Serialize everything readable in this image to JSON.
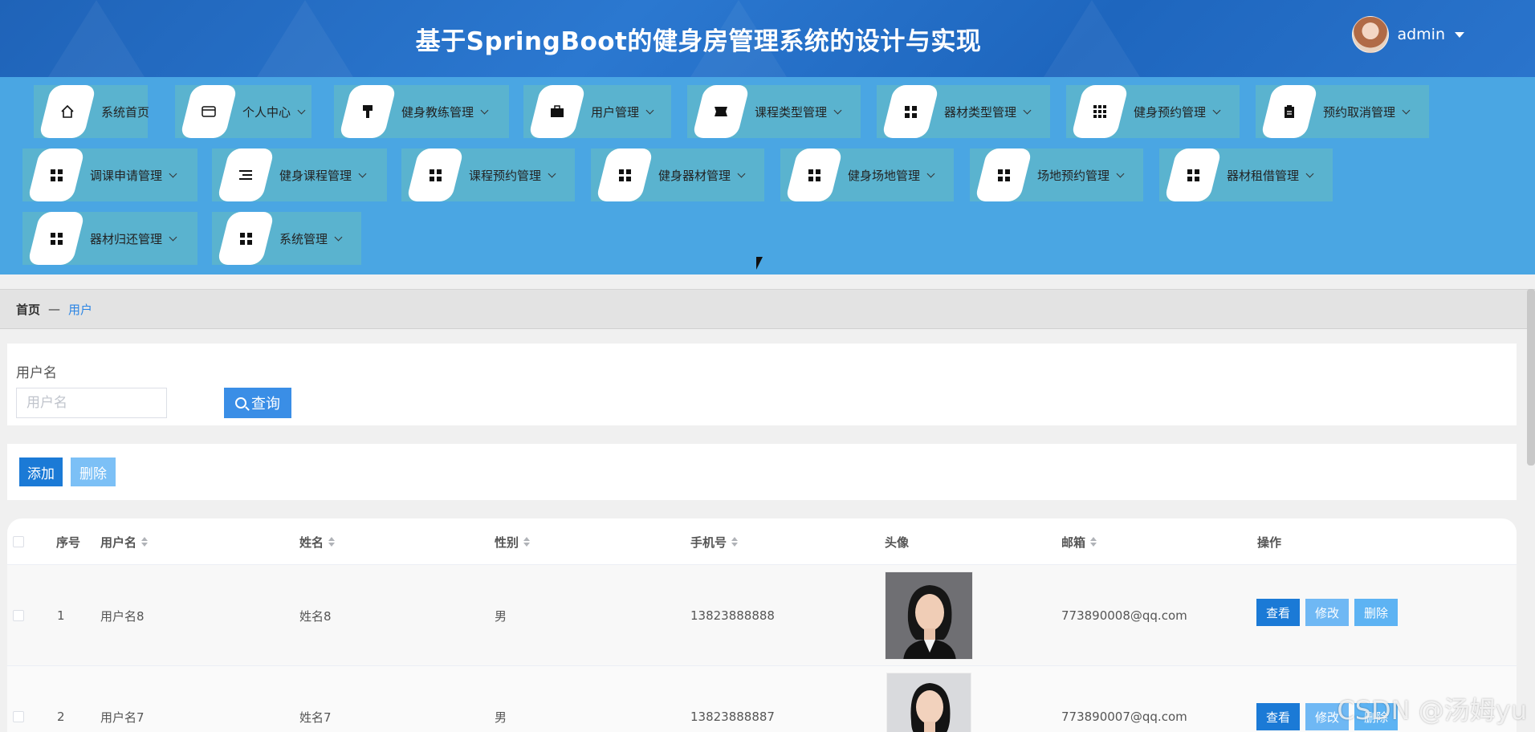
{
  "header": {
    "title": "基于SpringBoot的健身房管理系统的设计与实现",
    "username": "admin"
  },
  "nav": {
    "items": [
      {
        "label": "系统首页",
        "icon": "home-icon"
      },
      {
        "label": "个人中心",
        "icon": "wallet-icon"
      },
      {
        "label": "健身教练管理",
        "icon": "brush-icon"
      },
      {
        "label": "用户管理",
        "icon": "briefcase-icon"
      },
      {
        "label": "课程类型管理",
        "icon": "ticket-icon"
      },
      {
        "label": "器材类型管理",
        "icon": "grid-icon"
      },
      {
        "label": "健身预约管理",
        "icon": "grid9-icon"
      },
      {
        "label": "预约取消管理",
        "icon": "clipboard-icon"
      },
      {
        "label": "调课申请管理",
        "icon": "grid-icon"
      },
      {
        "label": "健身课程管理",
        "icon": "list-icon"
      },
      {
        "label": "课程预约管理",
        "icon": "grid-icon"
      },
      {
        "label": "健身器材管理",
        "icon": "grid-icon"
      },
      {
        "label": "健身场地管理",
        "icon": "grid-icon"
      },
      {
        "label": "场地预约管理",
        "icon": "grid-icon"
      },
      {
        "label": "器材租借管理",
        "icon": "grid-icon"
      },
      {
        "label": "器材归还管理",
        "icon": "grid-icon"
      },
      {
        "label": "系统管理",
        "icon": "grid-icon"
      }
    ]
  },
  "breadcrumb": {
    "home": "首页",
    "separator": "—",
    "current": "用户"
  },
  "search": {
    "label": "用户名",
    "placeholder": "用户名",
    "value": "",
    "button": "查询"
  },
  "actions": {
    "add": "添加",
    "delete": "删除"
  },
  "table": {
    "columns": {
      "index": "序号",
      "username": "用户名",
      "name": "姓名",
      "gender": "性别",
      "phone": "手机号",
      "avatar": "头像",
      "email": "邮箱",
      "ops": "操作"
    },
    "rows": [
      {
        "index": "1",
        "username": "用户名8",
        "name": "姓名8",
        "gender": "男",
        "phone": "13823888888",
        "email": "773890008@qq.com"
      },
      {
        "index": "2",
        "username": "用户名7",
        "name": "姓名7",
        "gender": "男",
        "phone": "13823888887",
        "email": "773890007@qq.com"
      }
    ],
    "op_view": "查看",
    "op_edit": "修改",
    "op_delete": "删除"
  },
  "watermark": "CSDN @汤姆yu",
  "colors": {
    "header": "#1f63b8",
    "nav": "#4aa6e3",
    "nav_item": "#5ab3cf",
    "primary": "#1b7ad6",
    "light_primary": "#7cc0f6",
    "breadcrumb_active": "#2b85e4"
  }
}
